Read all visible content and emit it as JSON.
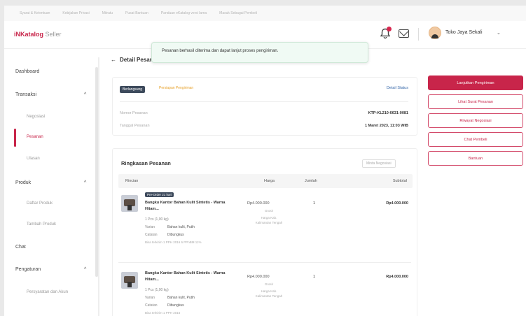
{
  "top_links": [
    "Syarat & Ketentuan",
    "Kebijakan Privasi",
    "Mitratu",
    "Pusat Bantuan",
    "Panduan eKatalog versi lama",
    "Masuk Sebagai Pembeli"
  ],
  "brand": {
    "logo_prefix": "iNKatalog",
    "logo_suffix": "Seller",
    "accent": "#c8254a"
  },
  "header": {
    "store_name": "Toko Jaya Sekali",
    "chevron": "⌄",
    "notification_count_shown": true
  },
  "sidebar": {
    "dashboard": "Dashboard",
    "transaksi": "Transaksi",
    "negosiasi": "Negosiasi",
    "pesanan": "Pesanan",
    "ulasan": "Ulasan",
    "produk": "Produk",
    "daftar_produk": "Daftar Produk",
    "tambah_produk": "Tambah Produk",
    "chat": "Chat",
    "pengaturan": "Pengaturan",
    "persyaratan": "Persyaratan dan Akun",
    "chevron_up": "^"
  },
  "toast": {
    "message": "Pesanan berhasil diterima dan dapat lanjut proses pengiriman."
  },
  "page": {
    "back_arrow": "←",
    "title": "Detail Pesanan"
  },
  "order": {
    "status_badge": "Berlangsung",
    "status_sub": "Persiapan Pengiriman",
    "detail_status": "Detail Status",
    "nomor_label": "Nomor Pesanan",
    "nomor_value": "KTP-KL210-6631-0081",
    "tanggal_label": "Tanggal Pesanan",
    "tanggal_value": "1 Maret 2023, 11:03 WIB"
  },
  "summary": {
    "title": "Ringkasan Pesanan",
    "minta_nego": "Minta Negosiasi",
    "headers": {
      "rincian": "Rincian",
      "harga": "Harga",
      "jumlah": "Jumlah",
      "subtotal": "Subtotal"
    },
    "items": [
      {
        "badge": "Pre-Order 21 hari",
        "name": "Bangku Kantor Bahan Kulit Sintetis - Warna Hitam...",
        "qty_line": "1 Pcs (1,00 kg)",
        "varian_label": "Varian",
        "varian_value": "Bahan kulit, Putih",
        "catatan_label": "Catatan",
        "catatan_value": "Dibungkus",
        "note": "Bisa terkirim 1 PPH 2016 6 PPnBM 11%",
        "harga": "Rp4.000.000",
        "harga_sub": "Grosir",
        "harga_sub2": "Harga Kab. Kalimantan Tengah",
        "jumlah": "1",
        "subtotal": "Rp4.000.000"
      },
      {
        "badge": "",
        "name": "Bangku Kantor Bahan Kulit Sintetis - Warna Hitam...",
        "qty_line": "1 Pcs (1,00 kg)",
        "varian_label": "Varian",
        "varian_value": "Bahan kulit, Putih",
        "catatan_label": "Catatan",
        "catatan_value": "Dibungkus",
        "note": "Bisa terkirim 1 PPH 2016",
        "harga": "Rp4.000.000",
        "harga_sub": "Grosir",
        "harga_sub2": "Harga Kab. Kalimantan Tengah",
        "jumlah": "1",
        "subtotal": "Rp4.000.000"
      }
    ]
  },
  "actions": {
    "lanjutkan": "Lanjutkan Pengiriman",
    "surat": "Lihat Surat Pesanan",
    "riwayat": "Riwayat Negosiasi",
    "chat": "Chat Pembeli",
    "bantuan": "Bantuan"
  },
  "icons": {
    "notification": "bell-icon",
    "mail": "mail-icon",
    "avatar": "avatar-icon"
  }
}
